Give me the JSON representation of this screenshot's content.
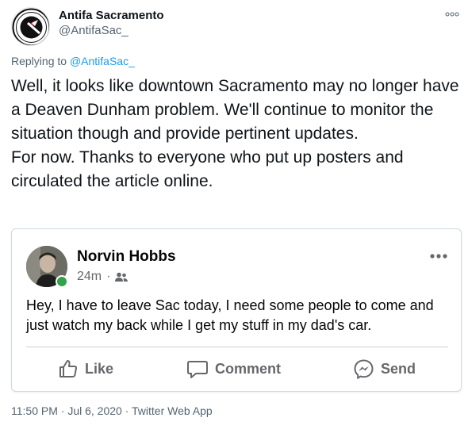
{
  "tweet": {
    "author": {
      "display_name": "Antifa Sacramento",
      "handle": "@AntifaSac_"
    },
    "reply": {
      "prefix": "Replying to ",
      "mention": "@AntifaSac_"
    },
    "text": "Well, it looks like downtown Sacramento may no longer have a Deaven Dunham problem. We'll continue to monitor the situation though and provide pertinent updates.\nFor now. Thanks to everyone who put up posters and circulated the article online.",
    "timestamp": "11:50 PM · Jul 6, 2020 · Twitter Web App"
  },
  "embedded_post": {
    "author": "Norvin Hobbs",
    "time": "24m",
    "separator": "·",
    "audience_icon": "friends-icon",
    "body": "Hey, I have to leave Sac today, I need some people to come and just watch my back while I get my stuff in my dad's car.",
    "actions": {
      "like": "Like",
      "comment": "Comment",
      "send": "Send"
    }
  },
  "colors": {
    "link": "#1d9bf0",
    "secondary_text": "#536471",
    "online": "#31a24c"
  }
}
